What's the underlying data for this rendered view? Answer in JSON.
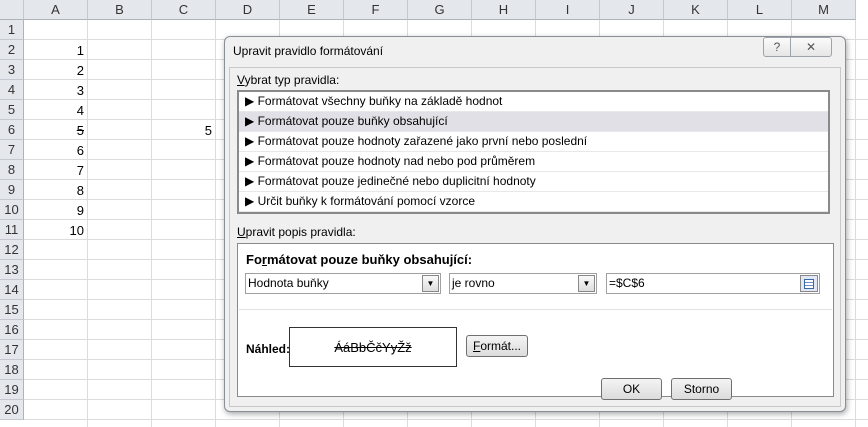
{
  "sheet": {
    "columns": [
      "A",
      "B",
      "C",
      "D",
      "E",
      "F",
      "G",
      "H",
      "I",
      "J",
      "K",
      "L",
      "M"
    ],
    "rows": [
      "1",
      "2",
      "3",
      "4",
      "5",
      "6",
      "7",
      "8",
      "9",
      "10",
      "11",
      "12",
      "13",
      "14",
      "15",
      "16",
      "17",
      "18",
      "19",
      "20"
    ],
    "col_a_values": [
      "",
      "1",
      "2",
      "3",
      "4",
      "5",
      "6",
      "7",
      "8",
      "9",
      "10"
    ],
    "c6": "5"
  },
  "dialog": {
    "title": "Upravit pravidlo formátování",
    "help_icon": "?",
    "close_icon": "✕",
    "select_type_label_u": "V",
    "select_type_label": "ybrat typ pravidla:",
    "rule_types": [
      "Formátovat všechny buňky na základě hodnot",
      "Formátovat pouze buňky obsahující",
      "Formátovat pouze hodnoty zařazené jako první nebo poslední",
      "Formátovat pouze hodnoty nad nebo pod průměrem",
      "Formátovat pouze jedinečné nebo duplicitní hodnoty",
      "Určit buňky k formátování pomocí vzorce"
    ],
    "selected_rule_index": 1,
    "edit_label_u": "U",
    "edit_label": "pravit popis pravidla:",
    "section_title_a": "Fo",
    "section_title_u": "r",
    "section_title_b": "mátovat pouze buňky obsahující:",
    "condition_field": "Hodnota buňky",
    "operator": "je rovno",
    "value": "=$C$6",
    "preview_label": "Náhled:",
    "preview_text": "ÁáBbČčYyŽž",
    "format_button_u": "F",
    "format_button": "ormát...",
    "ok": "OK",
    "cancel": "Storno"
  }
}
